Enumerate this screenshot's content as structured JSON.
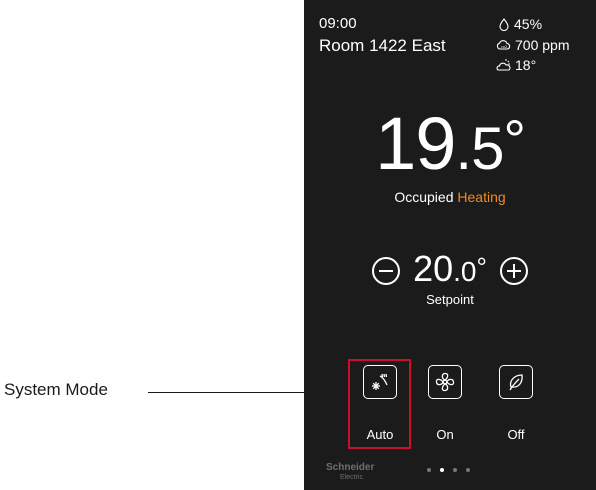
{
  "callout": {
    "label": "System Mode"
  },
  "header": {
    "time": "09:00",
    "room": "Room 1422 East"
  },
  "sensors": [
    {
      "icon": "humidity-drop-icon",
      "value": "45%"
    },
    {
      "icon": "co2-cloud-icon",
      "value": "700 ppm"
    },
    {
      "icon": "outdoor-weather-icon",
      "value": "18°"
    }
  ],
  "temperature": {
    "whole": "19",
    "decimal": ".5",
    "degree": "°"
  },
  "status": {
    "occupancy": "Occupied",
    "mode": "Heating"
  },
  "setpoint": {
    "whole": "20",
    "decimal": ".0",
    "degree": "°",
    "label": "Setpoint"
  },
  "modes": [
    {
      "icon": "auto-fan-icon",
      "label": "Auto",
      "highlighted": true
    },
    {
      "icon": "fan-icon",
      "label": "On",
      "highlighted": false
    },
    {
      "icon": "leaf-icon",
      "label": "Off",
      "highlighted": false
    }
  ],
  "brand": {
    "name": "Schneider",
    "sub": "Electric"
  },
  "pagination": {
    "pages": 4,
    "active": 1
  },
  "colors": {
    "background": "#1b1b1b",
    "accent": "#f08a24",
    "highlight": "#c8102e"
  }
}
